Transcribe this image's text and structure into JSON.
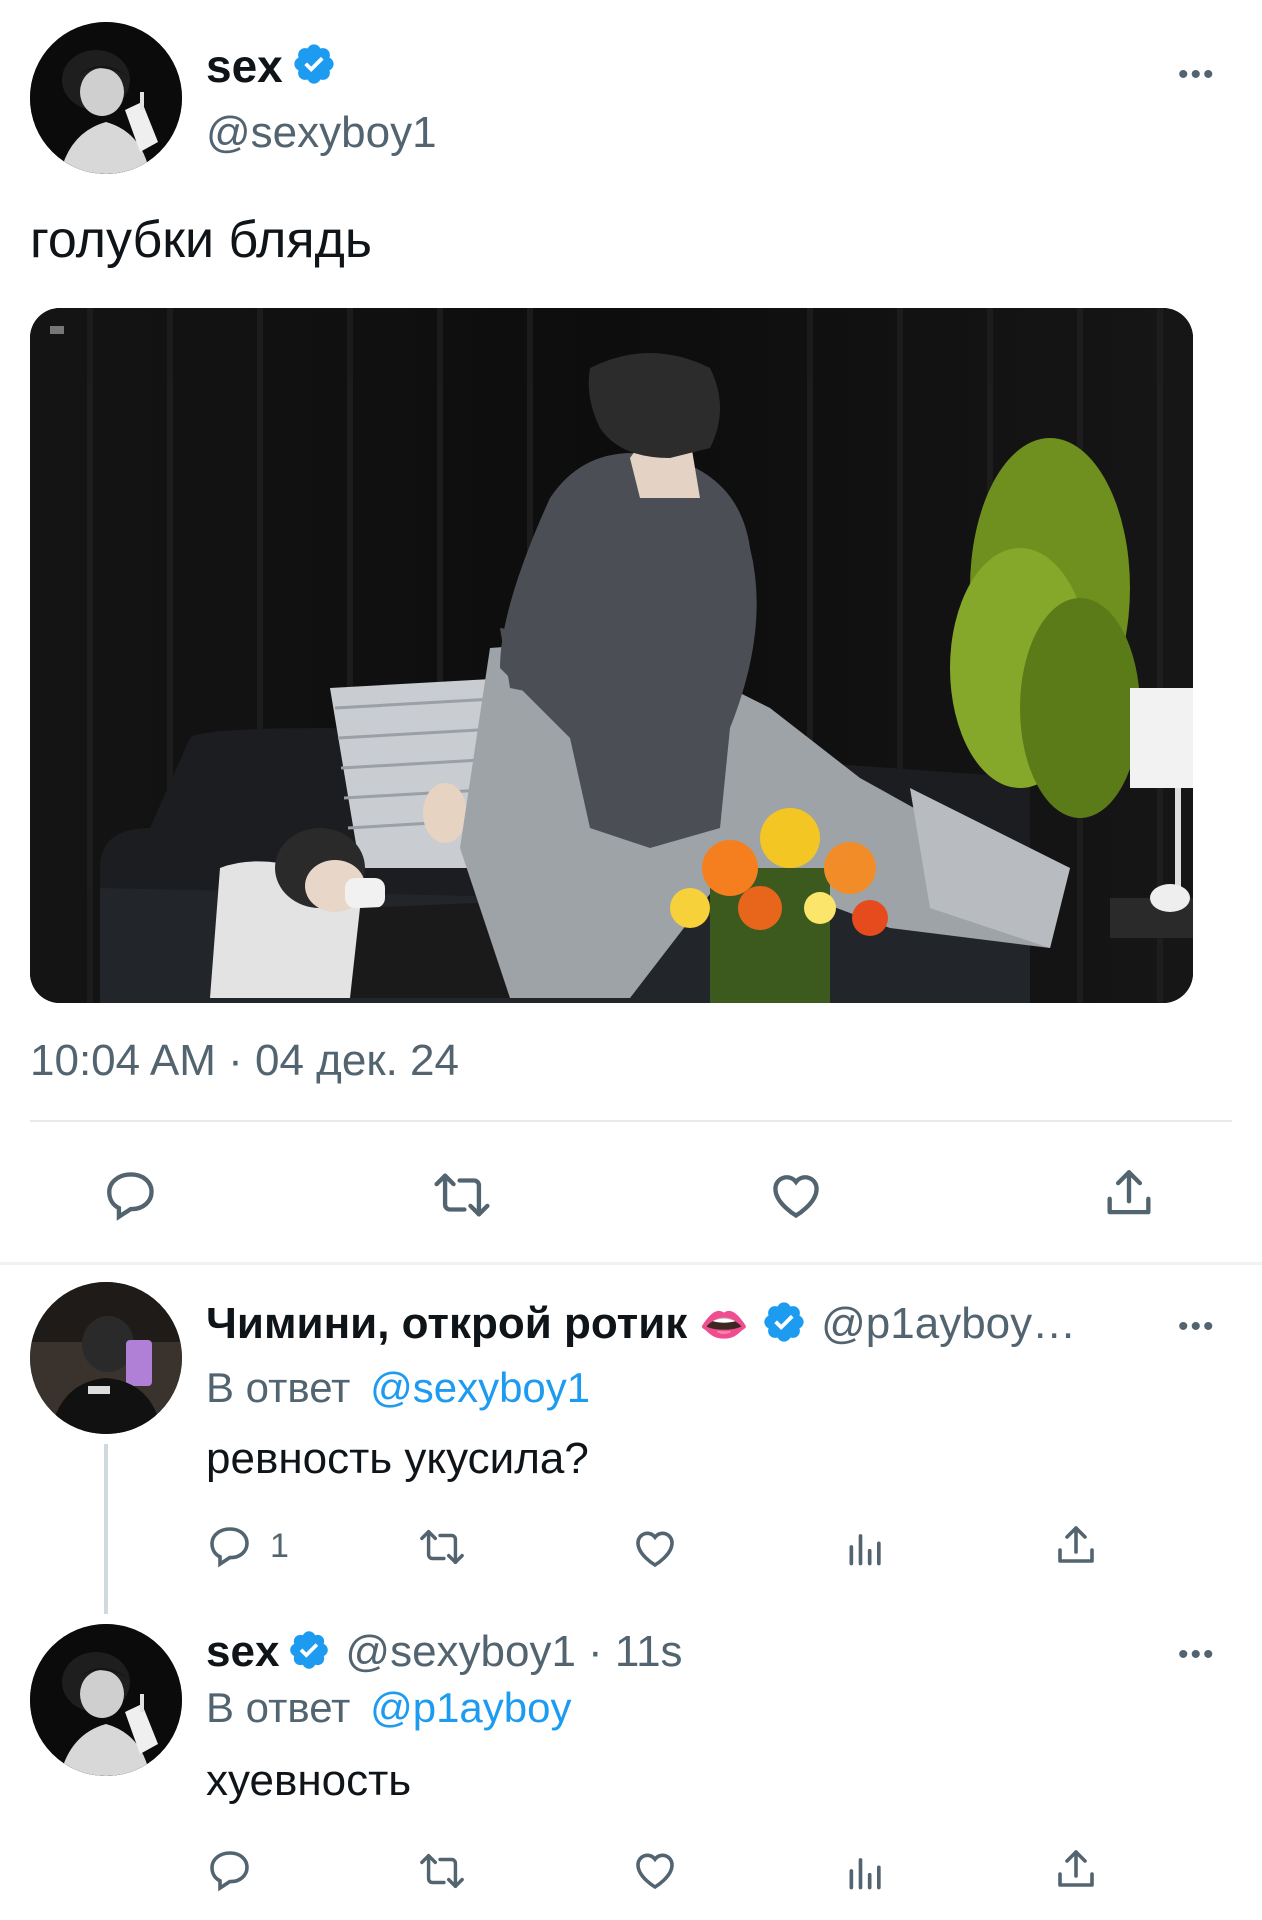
{
  "tweet": {
    "author_name": "sex",
    "author_handle": "@sexyboy1",
    "text": "голубки блядь",
    "timestamp": "10:04 AM · 04 дек. 24",
    "more": "•••",
    "avatar_icon": "user-avatar-photo",
    "actions": [
      "reply-icon",
      "retweet-icon",
      "like-icon",
      "share-icon"
    ]
  },
  "replies": [
    {
      "author_name": "Чимини, открой ротик",
      "emoji": "👄",
      "author_handle": "@p1ayboy…",
      "reply_prefix": "В ответ",
      "reply_mention": "@sexyboy1",
      "text": "ревность укусила?",
      "reply_count": "1",
      "more": "•••"
    },
    {
      "author_name": "sex",
      "author_handle": "@sexyboy1",
      "time": "· 11s",
      "reply_prefix": "В ответ",
      "reply_mention": "@p1ayboy",
      "text": "хуевность",
      "more": "•••"
    }
  ],
  "colors": {
    "accent": "#1d9bf0",
    "verified": "#1d9bf0",
    "secondary_text": "#536471",
    "divider": "#e7e9ea"
  }
}
